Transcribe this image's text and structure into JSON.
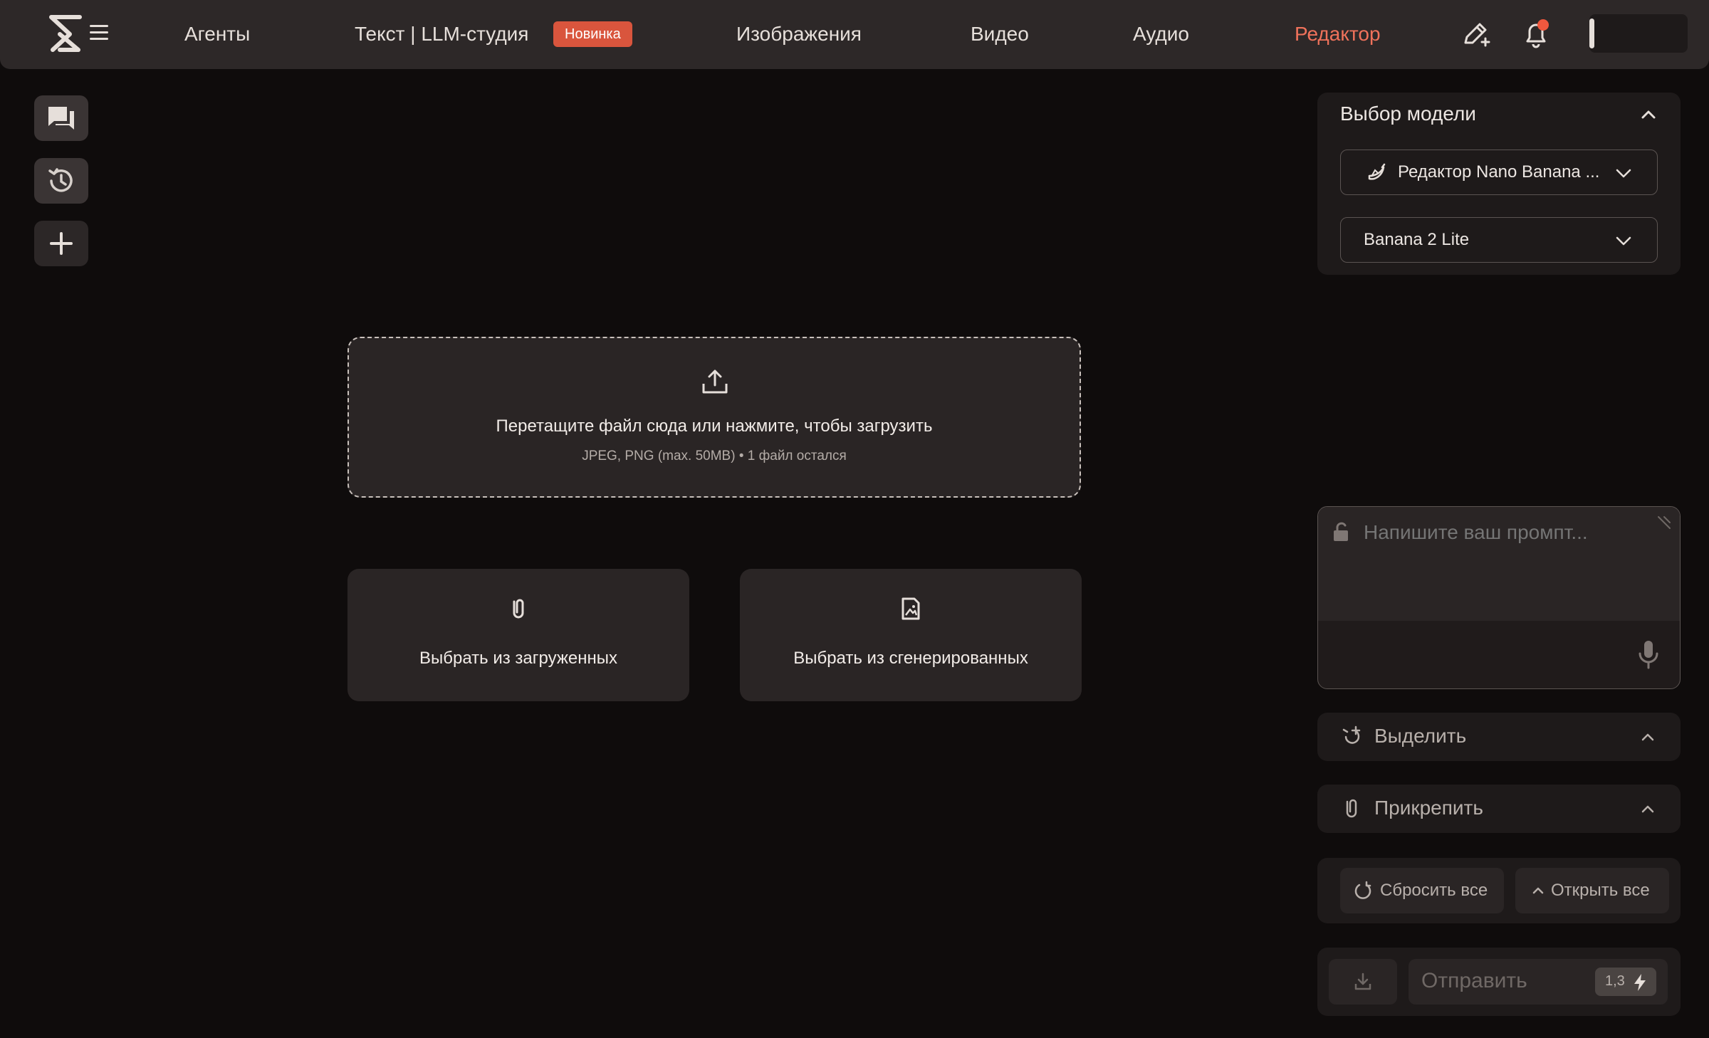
{
  "nav": {
    "items": [
      "Агенты",
      "Текст | LLM-студия",
      "Изображения",
      "Видео",
      "Аудио",
      "Редактор"
    ],
    "badge": "Новинка",
    "active_item": "Редактор",
    "accent_color": "#f0725b"
  },
  "sidebar": {
    "items": [
      {
        "icon": "chat-icon"
      },
      {
        "icon": "history-icon"
      },
      {
        "icon": "plus-icon"
      }
    ]
  },
  "upload": {
    "title": "Перетащите файл сюда или нажмите, чтобы загрузить",
    "subtitle": "JPEG, PNG (max. 50MB) • 1 файл остался",
    "pick_uploaded": "Выбрать из загруженных",
    "pick_generated": "Выбрать из сгенерированных"
  },
  "model_panel": {
    "title": "Выбор модели",
    "model_select": "Редактор Nano Banana ...",
    "version_select": "Banana 2 Lite"
  },
  "prompt": {
    "placeholder": "Напишите ваш промпт..."
  },
  "sections": {
    "highlight": "Выделить",
    "attach": "Прикрепить"
  },
  "actions": {
    "reset": "Сбросить все",
    "open_all": "Открыть все"
  },
  "send": {
    "label": "Отправить",
    "cost": "1,3"
  }
}
